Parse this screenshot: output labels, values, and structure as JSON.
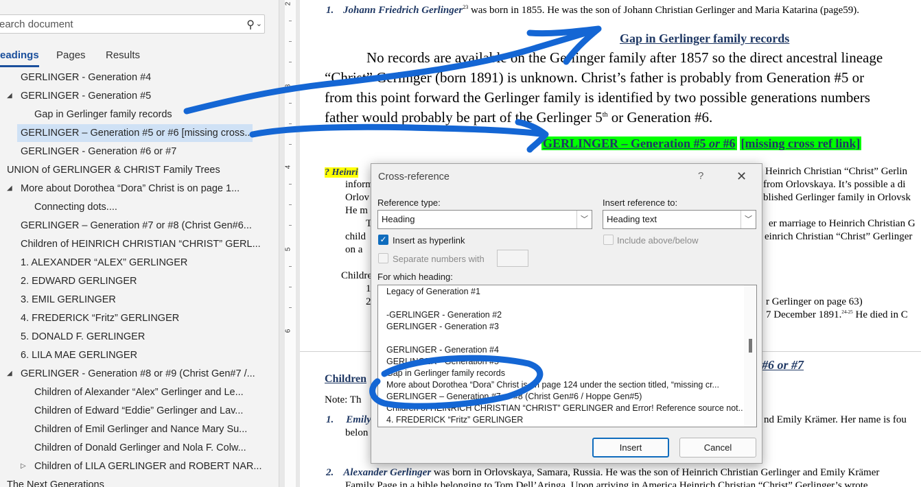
{
  "nav": {
    "search_placeholder": "earch document",
    "tabs": [
      {
        "label": "eadings",
        "active": true
      },
      {
        "label": "Pages",
        "active": false
      },
      {
        "label": "Results",
        "active": false
      }
    ],
    "items": [
      {
        "label": "GERLINGER - Generation #4"
      },
      {
        "label": "GERLINGER - Generation #5"
      },
      {
        "label": "Gap in Gerlinger family records"
      },
      {
        "label": "GERLINGER – Generation #5 or #6 [missing cross..."
      },
      {
        "label": "GERLINGER - Generation #6 or #7"
      },
      {
        "label": "UNION of GERLINGER & CHRIST Family Trees"
      },
      {
        "label": "More about Dorothea “Dora” Christ is on page 1..."
      },
      {
        "label": "Connecting dots...."
      },
      {
        "label": "GERLINGER – Generation #7 or  #8 (Christ Gen#6..."
      },
      {
        "label": "Children of HEINRICH CHRISTIAN “CHRIST” GERL..."
      },
      {
        "label": "1. ALEXANDER “ALEX” GERLINGER"
      },
      {
        "label": "2. EDWARD GERLINGER"
      },
      {
        "label": "3. EMIL GERLINGER"
      },
      {
        "label": "4. FREDERICK “Fritz” GERLINGER"
      },
      {
        "label": "5. DONALD F. GERLINGER"
      },
      {
        "label": "6. LILA MAE GERLINGER"
      },
      {
        "label": "GERLINGER - Generation #8 or #9 (Christ Gen#7 /..."
      },
      {
        "label": "Children of Alexander “Alex” Gerlinger  and Le..."
      },
      {
        "label": "Children of Edward “Eddie” Gerlinger and Lav..."
      },
      {
        "label": "Children of Emil Gerlinger and Nance Mary Su..."
      },
      {
        "label": "Children of Donald Gerlinger and Nola F. Colw..."
      },
      {
        "label": "Children of LILA GERLINGER and ROBERT NAR..."
      },
      {
        "label": "The Next Generations"
      }
    ]
  },
  "ruler": {
    "numbers": [
      "2",
      "3",
      "4",
      "5",
      "6"
    ]
  },
  "doc": {
    "line1_num": "1.",
    "line1_name": "Johann Friedrich Gerlinger",
    "line1_sup": "23",
    "line1_rest": " was born in 1855. He was the son of Johann Christian Gerlinger and Maria Katarina (page59).",
    "gap_heading": "Gap in Gerlinger family records",
    "para1": "No records are available on the Gerlinger family after 1857 so the direct ancestral lineage",
    "para2": "“Christ” Gerlinger (born 1891) is unknown.  Christ’s father is probably from Generation #5 or",
    "para3": "from this point forward the Gerlinger family is identified by two possible generations numbers",
    "para4a": "father would probably be part of the Gerlinger 5",
    "para4sup": "th",
    "para4b": " or  Generation #6.",
    "green_heading_a": "GERLINGER – Generation #5 ",
    "green_heading_or": "or",
    "green_heading_b": " #6",
    "green_heading_c": "[missing cross ref link]",
    "q_mark": "? Heinri",
    "r1": "Heinrich Christian “Christ” Gerlin",
    "l2": "inform",
    "r2": "from Orlovskaya.  It’s possible a di",
    "l3": "Orlov",
    "r3": "blished Gerlinger family in Orlovsk",
    "l4": "He m",
    "l5": "T",
    "r5": "er marriage to Heinrich Christian G",
    "l6": "child",
    "r6": "einrich Christian “Christ” Gerlinger",
    "l7": "on a",
    "l8": "Childre",
    "l9": "1",
    "r9": "r Gerlinger on page 63)",
    "l10": "2",
    "r10a": "7 December 1891.",
    "r10sup": "24-25",
    "r10b": " He died in C",
    "r11": "#6 or #7",
    "l12": "Children",
    "l13": "Note:  Th",
    "l14": "1.",
    "l14b": "Emily",
    "r14": "nd Emily Krämer.  Her name is fou",
    "l15": "belon",
    "l16": "2.",
    "l16b": "Alexander Gerlinger",
    "l16c": " was born in Orlovskaya, Samara, Russia.  He was the son of Heinrich Christian Gerlinger and Emily Krämer",
    "l17": "Family Page in a bible belonging to Tom Dell’Aringa.  Upon arriving in America Heinrich Christian “Christ” Gerlinger’s wrote"
  },
  "dialog": {
    "title": "Cross-reference",
    "help": "?",
    "close": "✕",
    "ref_type_label": "Reference type:",
    "ref_type_value": "Heading",
    "insert_ref_label": "Insert reference to:",
    "insert_ref_value": "Heading text",
    "hyperlink_label": "Insert as hyperlink",
    "include_label": "Include above/below",
    "separate_label": "Separate numbers with",
    "which_label": "For which heading:",
    "headings": [
      "   Legacy of Generation #1",
      "",
      "-GERLINGER - Generation #2",
      "GERLINGER - Generation #3",
      "",
      "GERLINGER - Generation #4",
      "GERLINGER - Generation #5",
      "   Gap in Gerlinger family records",
      "More about Dorothea “Dora” Christ is on page 124 under the section titled, “missing cr...",
      "GERLINGER – Generation #7 or  #8 (Christ Gen#6 / Hoppe Gen#5)",
      "Children of HEINRICH CHRISTIAN “CHRIST” GERLINGER and Error! Reference source not...",
      "4. FREDERICK “Fritz” GERLINGER"
    ],
    "insert_button": "Insert",
    "cancel_button": "Cancel"
  },
  "colors": {
    "accent": "#1a4f9c",
    "ink": "#1466d4",
    "highlight_green": "#00ff00",
    "highlight_yellow": "#ffff00"
  }
}
